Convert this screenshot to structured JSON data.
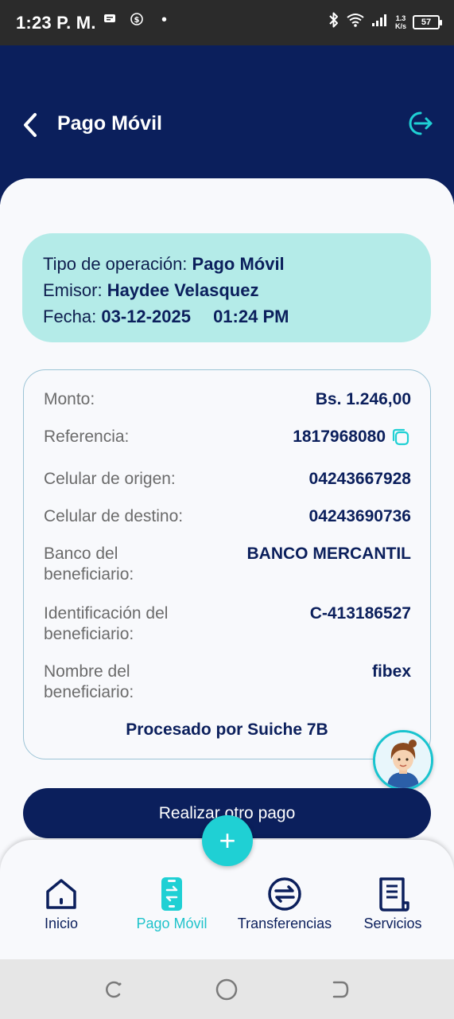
{
  "status_bar": {
    "time": "1:23 P. M.",
    "speed_value": "1.3",
    "speed_unit": "K/s",
    "battery": "57"
  },
  "header": {
    "title": "Pago Móvil"
  },
  "summary": {
    "tipo_label": "Tipo de operación:",
    "tipo_value": "Pago Móvil",
    "emisor_label": "Emisor:",
    "emisor_value": "Haydee Velasquez",
    "fecha_label": "Fecha:",
    "fecha_date": "03-12-2025",
    "fecha_time": "01:24 PM"
  },
  "details": {
    "monto_label": "Monto:",
    "monto_value": "Bs. 1.246,00",
    "referencia_label": "Referencia:",
    "referencia_value": "1817968080",
    "origen_label": "Celular de origen:",
    "origen_value": "04243667928",
    "destino_label": "Celular de destino:",
    "destino_value": "04243690736",
    "banco_label": "Banco del beneficiario:",
    "banco_value": "BANCO MERCANTIL",
    "identificacion_label": "Identificación del beneficiario:",
    "identificacion_value": "C-413186527",
    "nombre_label": "Nombre del beneficiario:",
    "nombre_value": "fibex",
    "processed_by": "Procesado por Suiche 7B"
  },
  "actions": {
    "primary_label": "Realizar otro pago",
    "fab_label": "+"
  },
  "bottom_nav": {
    "items": [
      {
        "label": "Inicio",
        "icon": "home-icon"
      },
      {
        "label": "Pago Móvil",
        "icon": "mobile-payment-icon",
        "active": true
      },
      {
        "label": "Transferencias",
        "icon": "transfer-icon"
      },
      {
        "label": "Servicios",
        "icon": "services-icon"
      }
    ]
  },
  "colors": {
    "primary": "#0b1f5c",
    "accent": "#1fd0d4",
    "summary_bg": "#b4ebe8"
  }
}
